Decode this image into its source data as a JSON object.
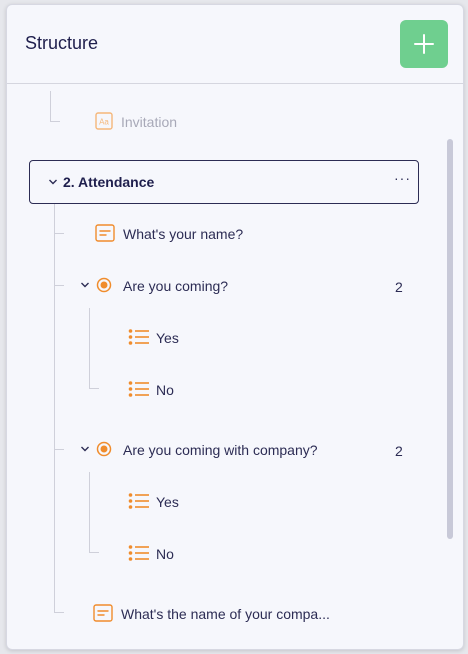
{
  "panel": {
    "title": "Structure"
  },
  "tree": {
    "top_item": {
      "label": "Invitation",
      "icon": "text-format-icon"
    },
    "section": {
      "label": "2. Attendance",
      "more": "···"
    },
    "items": {
      "q_name": {
        "label": "What's your name?",
        "icon": "short-text-icon"
      },
      "q_coming": {
        "label": "Are you coming?",
        "count": "2",
        "icon": "radio-icon",
        "options": [
          "Yes",
          "No"
        ]
      },
      "q_company": {
        "label": "Are you coming with company?",
        "count": "2",
        "icon": "radio-icon",
        "options": [
          "Yes",
          "No"
        ]
      },
      "q_company_name": {
        "label": "What's the name of your compa...",
        "icon": "short-text-icon"
      }
    }
  },
  "colors": {
    "accent": "#f08c2c",
    "add_button": "#6fcf8f",
    "text": "#2c2c54"
  }
}
